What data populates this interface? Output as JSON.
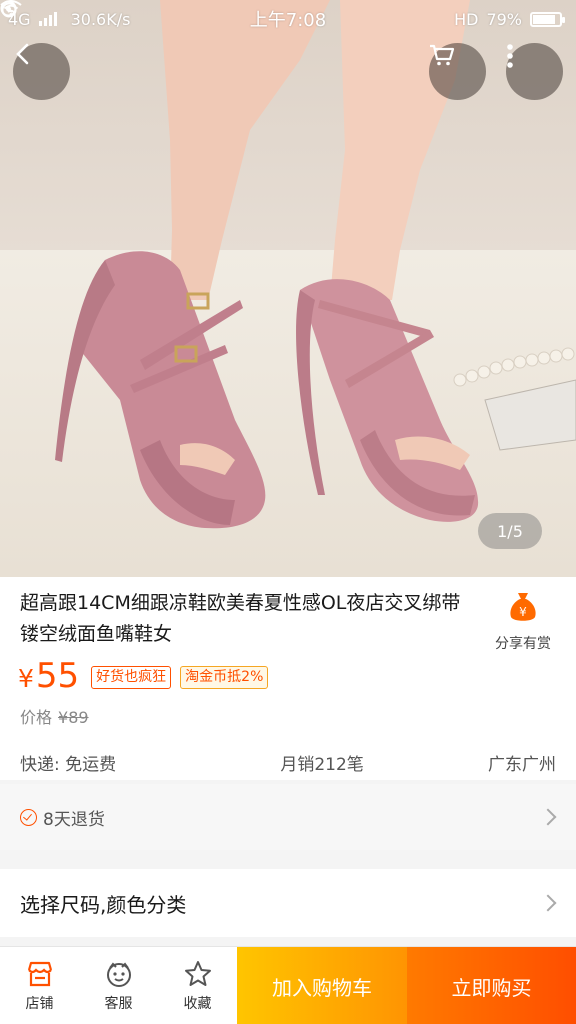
{
  "status_bar": {
    "network": "4G",
    "speed": "30.6K/s",
    "time": "上午7:08",
    "hd": "HD",
    "battery": "79%",
    "battery_level": 0.79
  },
  "gallery": {
    "pager": "1/5"
  },
  "product": {
    "title": "超高跟14CM细跟凉鞋欧美春夏性感OL夜店交叉绑带镂空绒面鱼嘴鞋女",
    "price_symbol": "¥",
    "price": "55",
    "tags": [
      "好货也疯狂",
      "淘金币抵2%"
    ],
    "original_price_label": "价格",
    "original_price": "¥89",
    "shipping": "快递: 免运费",
    "monthly_sales": "月销212笔",
    "location": "广东广州",
    "share_label": "分享有赏"
  },
  "service": {
    "return_policy": "8天退货"
  },
  "options": {
    "select_label": "选择尺码,颜色分类"
  },
  "bottom_bar": {
    "store": "店铺",
    "service": "客服",
    "favorite": "收藏",
    "add_to_cart": "加入购物车",
    "buy_now": "立即购买"
  },
  "colors": {
    "accent": "#ff5000",
    "cart_button": "#ffb000",
    "buy_button": "#ff5a00"
  }
}
